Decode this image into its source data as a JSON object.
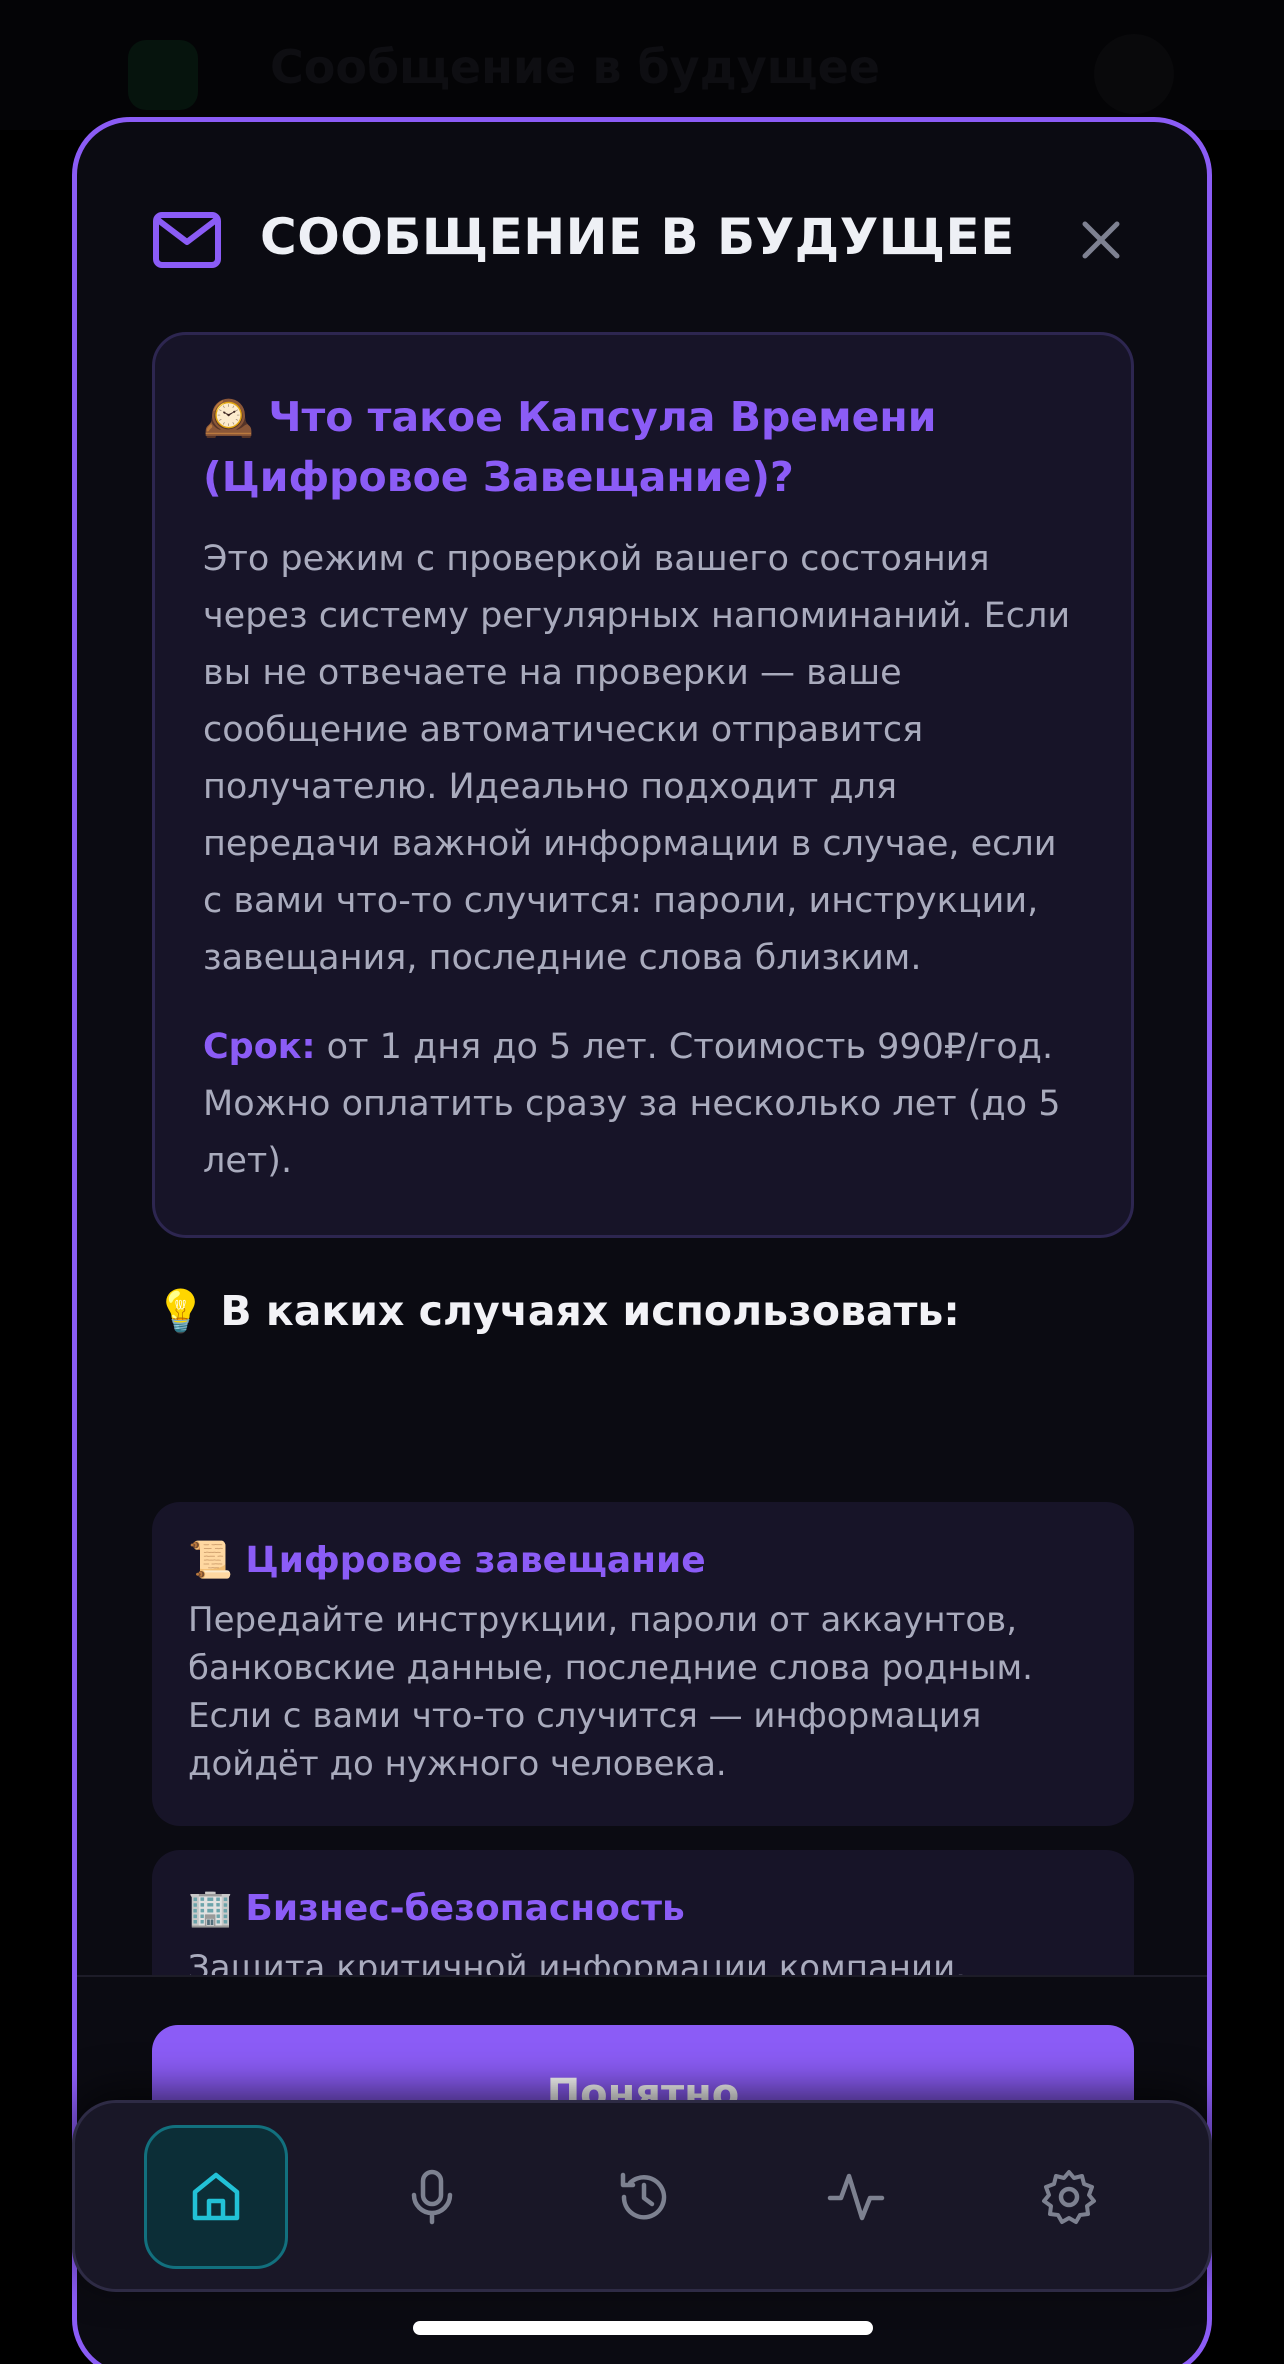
{
  "background": {
    "title": "Сообщение в будущее"
  },
  "modal": {
    "title": "СООБЩЕНИЕ В БУДУЩЕЕ",
    "info": {
      "emoji": "🕰️",
      "title": "Что такое Капсула Времени (Цифровое Завещание)?",
      "description": "Это режим с проверкой вашего состояния через систему регулярных напоминаний. Если вы не отвечаете на проверки — ваше сообщение автоматически отправится получателю. Идеально подходит для передачи важной информации в случае, если с вами что-то случится: пароли, инструкции, завещания, последние слова близким.",
      "term_label": "Срок:",
      "term_text": " от 1 дня до 5 лет. Стоимость 990₽/год. Можно оплатить сразу за несколько лет (до 5 лет)."
    },
    "use_cases_heading_emoji": "💡",
    "use_cases_heading": "В каких случаях использовать:",
    "use_cases": [
      {
        "emoji": "📜",
        "title": "Цифровое завещание",
        "text": "Передайте инструкции, пароли от аккаунтов, банковские данные, последние слова родным. Если с вами что-то случится — информация дойдёт до нужного человека."
      },
      {
        "emoji": "🏢",
        "title": "Бизнес-безопасность",
        "text": "Защита критичной информации компании. Доступы к серверам, криптокошелькам, важным договорам. Если владелец бизнеса внезапно"
      }
    ],
    "confirm_label": "Понятно"
  },
  "nav": {
    "items": [
      {
        "icon": "home-icon",
        "active": true
      },
      {
        "icon": "microphone-icon",
        "active": false
      },
      {
        "icon": "history-icon",
        "active": false
      },
      {
        "icon": "activity-icon",
        "active": false
      },
      {
        "icon": "settings-icon",
        "active": false
      }
    ]
  },
  "colors": {
    "accent": "#8b5cf6",
    "card": "#171428",
    "nav_active": "#12707e"
  }
}
